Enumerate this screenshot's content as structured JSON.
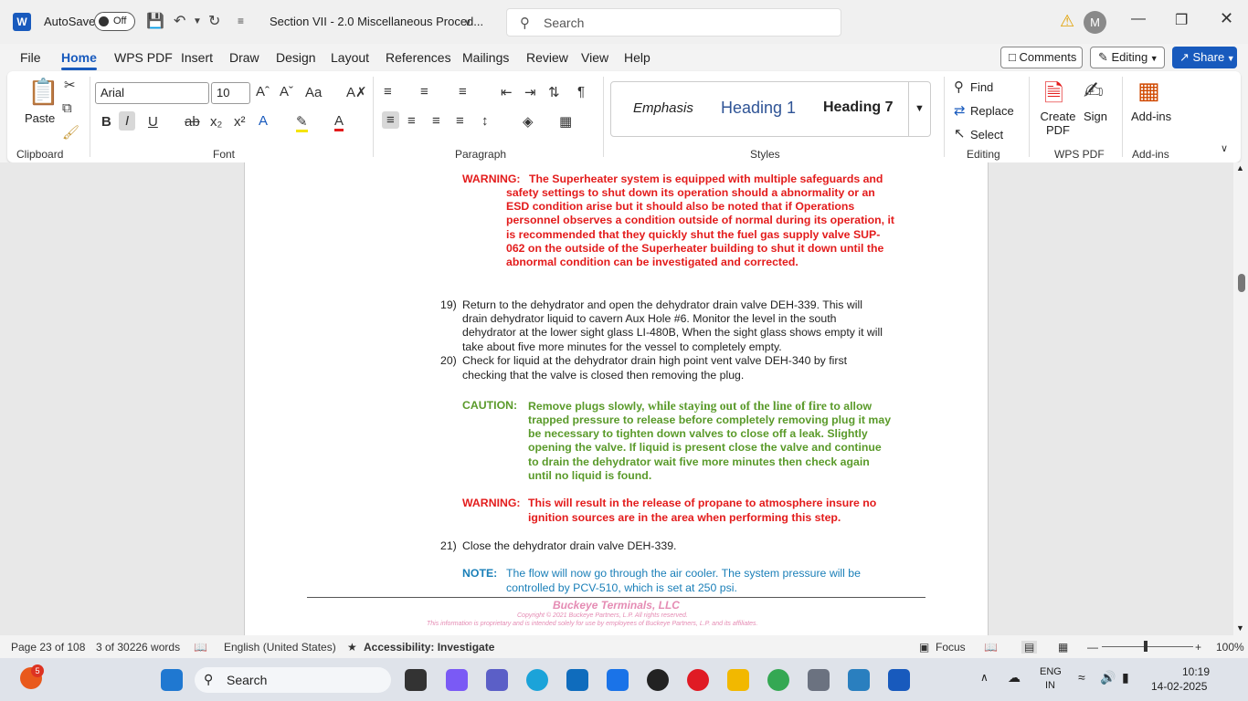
{
  "titlebar": {
    "app_letter": "W",
    "autosave_label": "AutoSave",
    "autosave_state": "Off",
    "doc_title": "Section VII - 2.0 Miscellaneous Proced...",
    "search_placeholder": "Search",
    "avatar_initial": "M"
  },
  "menu": {
    "items": [
      "File",
      "Home",
      "WPS PDF",
      "Insert",
      "Draw",
      "Design",
      "Layout",
      "References",
      "Mailings",
      "Review",
      "View",
      "Help"
    ],
    "active": "Home",
    "comments": "Comments",
    "editing": "Editing",
    "share": "Share"
  },
  "ribbon": {
    "paste": "Paste",
    "font_name": "Arial",
    "font_size": "10",
    "styles": [
      "Emphasis",
      "Heading 1",
      "Heading 7"
    ],
    "find": "Find",
    "replace": "Replace",
    "select": "Select",
    "create_pdf": "Create PDF",
    "sign": "Sign",
    "addins": "Add-ins",
    "groups": [
      "Clipboard",
      "Font",
      "Paragraph",
      "Styles",
      "Editing",
      "WPS PDF",
      "Add-ins"
    ]
  },
  "document": {
    "warning1_label": "WARNING:",
    "warning1_lines": [
      "The Superheater system is equipped with multiple safeguards and",
      "safety settings to shut down its operation should a abnormality or an",
      "ESD condition arise but it should also be noted that if Operations",
      "personnel observes a condition outside of normal during its operation, it",
      "is recommended that they quickly shut the fuel gas supply valve SUP-",
      "062 on the outside of the Superheater building to shut it down until the",
      "abnormal condition can be investigated and corrected."
    ],
    "step19_num": "19)",
    "step19_lines": [
      "Return to the dehydrator and open the dehydrator drain valve DEH-339. This will",
      "drain dehydrator liquid to cavern Aux Hole #6. Monitor the level in the south",
      "dehydrator at the lower sight glass LI-480B, When the sight glass shows empty it will",
      "take about five more minutes for the vessel to completely empty."
    ],
    "step20_num": "20)",
    "step20_lines": [
      "Check for liquid at the dehydrator drain high point vent valve DEH-340 by first",
      "checking that the valve is closed then removing the plug."
    ],
    "caution_label": "CAUTION:",
    "caution_line1_a": "Remove plugs slowly, ",
    "caution_line1_b": "while staying out of the line of fire",
    "caution_line1_c": " to allow",
    "caution_lines": [
      "trapped pressure to release before completely removing plug it may",
      "be necessary to tighten down valves to close off a leak. Slightly",
      "opening the valve. If liquid is present close the valve and continue",
      "to drain the dehydrator wait five more minutes then check again",
      "until no liquid is found."
    ],
    "warning2_label": "WARNING:",
    "warning2_line1": "This will result in the release of propane to atmosphere insure no",
    "warning2_line2": "ignition sources are in the area when performing this step.",
    "step21_num": "21)",
    "step21_text": "Close the dehydrator drain valve DEH-339.",
    "note_label": "NOTE:",
    "note_lines": [
      "The flow will now go through the air cooler. The system pressure will be",
      "controlled by PCV-510, which is set at 250 psi."
    ],
    "footer_company": "Buckeye Terminals, LLC",
    "footer_copyright": "Copyright © 2021 Buckeye Partners, L.P. All rights reserved.",
    "footer_notice": "This information is proprietary and is intended solely for use by employees of Buckeye Partners, L.P. and its affiliates."
  },
  "status": {
    "page": "Page 23 of 108",
    "words": "3 of 30226 words",
    "language": "English (United States)",
    "accessibility": "Accessibility: Investigate",
    "focus": "Focus",
    "zoom": "100%"
  },
  "taskbar": {
    "search": "Search",
    "badge": "5",
    "lang1": "ENG",
    "lang2": "IN",
    "time": "10:19",
    "date": "14-02-2025"
  }
}
